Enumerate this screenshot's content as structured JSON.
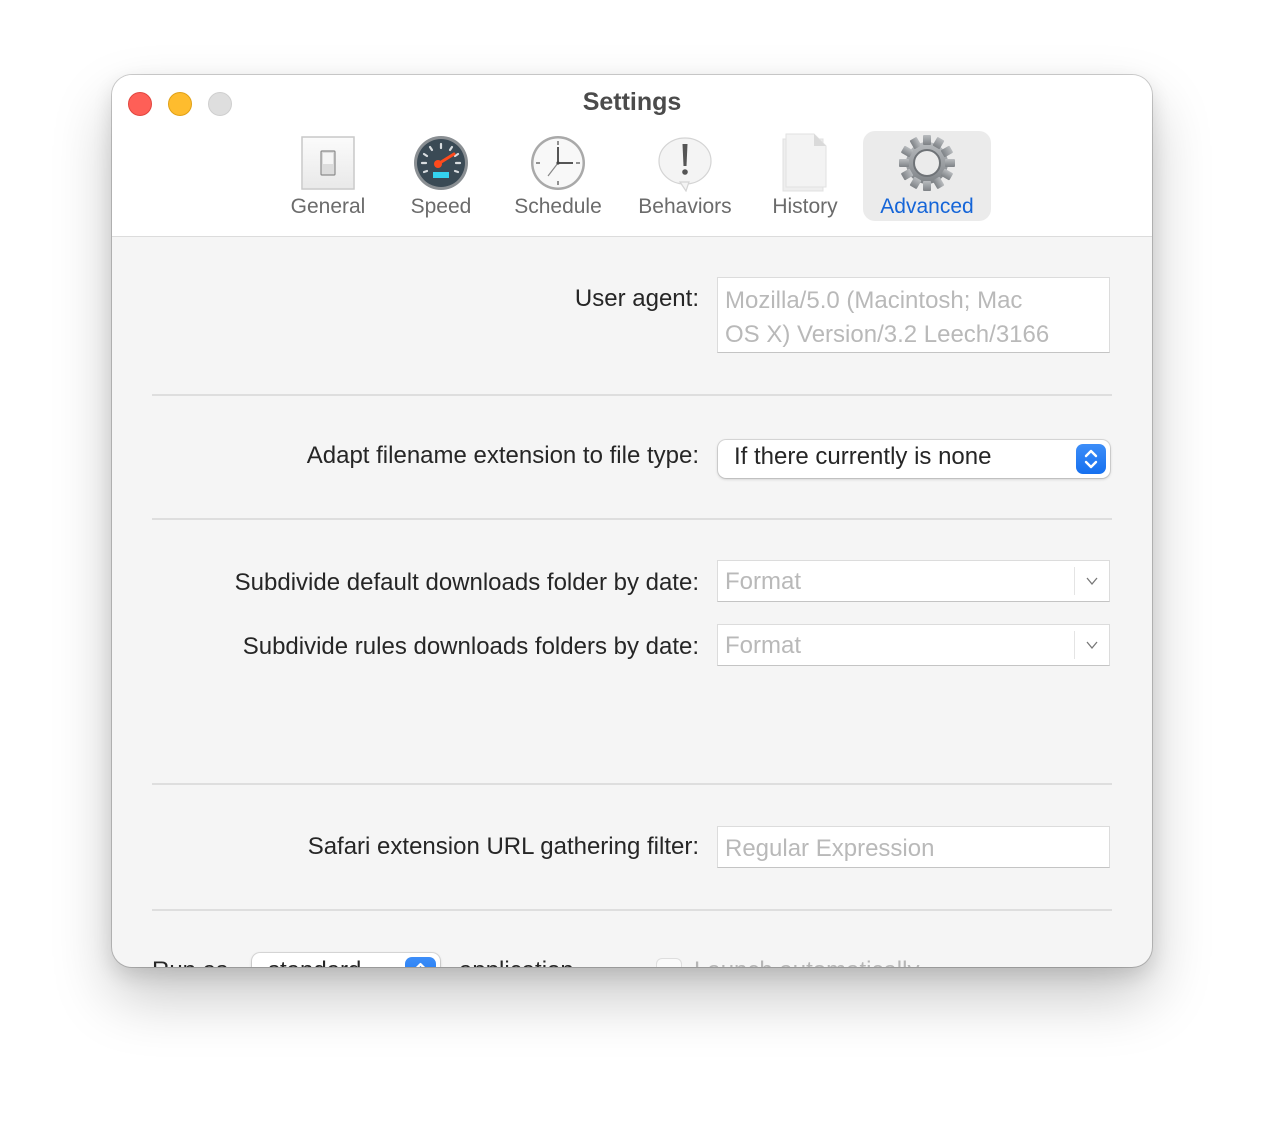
{
  "window": {
    "title": "Settings",
    "traffic_lights": [
      "close",
      "minimize",
      "zoom"
    ]
  },
  "toolbar": {
    "items": [
      {
        "label": "General",
        "icon": "light-switch-icon",
        "selected": false
      },
      {
        "label": "Speed",
        "icon": "speedometer-icon",
        "selected": false
      },
      {
        "label": "Schedule",
        "icon": "clock-icon",
        "selected": false
      },
      {
        "label": "Behaviors",
        "icon": "exclamation-bubble-icon",
        "selected": false
      },
      {
        "label": "History",
        "icon": "document-stack-icon",
        "selected": false
      },
      {
        "label": "Advanced",
        "icon": "gear-icon",
        "selected": true
      }
    ],
    "selected_color": "#1565d8"
  },
  "advanced": {
    "user_agent": {
      "label": "User agent:",
      "placeholder_line1": "Mozilla/5.0 (Macintosh; Mac",
      "placeholder_line2": "OS X) Version/3.2 Leech/3166"
    },
    "adapt_extension": {
      "label": "Adapt filename extension to file type:",
      "value": "If there currently is none"
    },
    "subdivide_default": {
      "label": "Subdivide default downloads folder by date:",
      "placeholder": "Format"
    },
    "subdivide_rules": {
      "label": "Subdivide rules downloads folders by date:",
      "placeholder": "Format"
    },
    "safari_filter": {
      "label": "Safari extension URL gathering filter:",
      "placeholder": "Regular Expression"
    },
    "run_as": {
      "prefix": "Run as",
      "value": "standard",
      "suffix": "application",
      "dash": "—",
      "launch_label": "Launch automatically",
      "launch_checked": false
    }
  }
}
